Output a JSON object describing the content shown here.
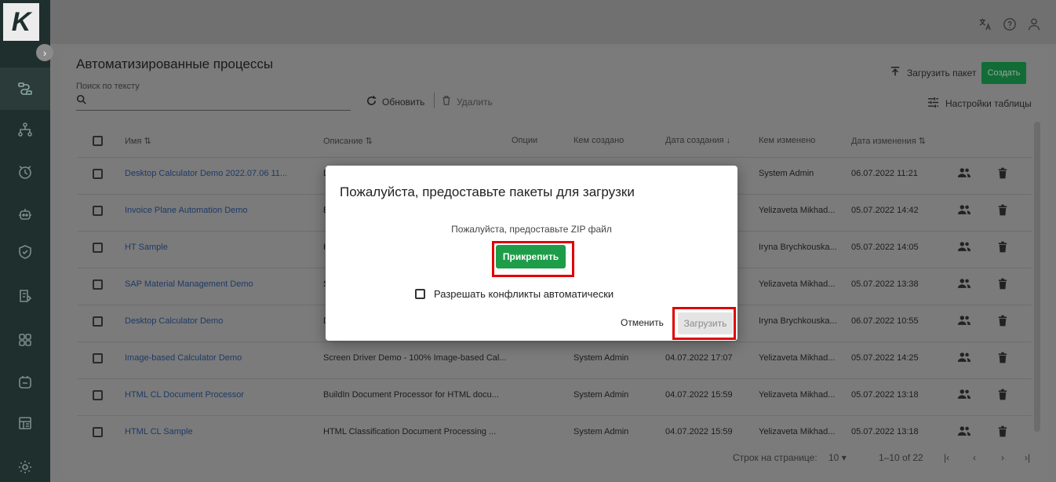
{
  "app": {
    "logo_letter": "K"
  },
  "sidebar": {
    "items": [
      {
        "icon": "processes-icon"
      },
      {
        "icon": "hierarchy-icon"
      },
      {
        "icon": "clock-icon"
      },
      {
        "icon": "robot-icon"
      },
      {
        "icon": "shield-icon"
      },
      {
        "icon": "queue-icon"
      },
      {
        "icon": "grid-icon"
      },
      {
        "icon": "storage-icon"
      },
      {
        "icon": "calendar-icon"
      },
      {
        "icon": "settings-icon"
      }
    ]
  },
  "header": {
    "title": "Автоматизированные процессы",
    "search_label": "Поиск по тексту",
    "refresh_label": "Обновить",
    "delete_label": "Удалить",
    "upload_package_label": "Загрузить пакет",
    "create_label": "Создать",
    "table_settings_label": "Настройки таблицы"
  },
  "table": {
    "columns": [
      "Имя",
      "Описание",
      "Опции",
      "Кем создано",
      "Дата создания",
      "Кем изменено",
      "Дата изменения"
    ],
    "rows": [
      {
        "name": "Desktop Calculator Demo 2022.07.06 11...",
        "description": "D",
        "created_by": "",
        "created_at": "",
        "modified_by": "System Admin",
        "modified_at": "06.07.2022 11:21"
      },
      {
        "name": "Invoice Plane Automation Demo",
        "description": "E",
        "created_by": "",
        "created_at": "",
        "modified_by": "Yelizaveta Mikhad...",
        "modified_at": "05.07.2022 14:42"
      },
      {
        "name": "HT Sample",
        "description": "H",
        "created_by": "",
        "created_at": "",
        "modified_by": "Iryna Brychkouska...",
        "modified_at": "05.07.2022 14:05"
      },
      {
        "name": "SAP Material Management Demo",
        "description": "S",
        "created_by": "",
        "created_at": "",
        "modified_by": "Yelizaveta Mikhad...",
        "modified_at": "05.07.2022 13:38"
      },
      {
        "name": "Desktop Calculator Demo",
        "description": "D",
        "created_by": "",
        "created_at": "",
        "modified_by": "Iryna Brychkouska...",
        "modified_at": "06.07.2022 10:55"
      },
      {
        "name": "Image-based Calculator Demo",
        "description": "Screen Driver Demo - 100% Image-based Cal...",
        "created_by": "System Admin",
        "created_at": "04.07.2022 17:07",
        "modified_by": "Yelizaveta Mikhad...",
        "modified_at": "05.07.2022 14:25"
      },
      {
        "name": "HTML CL Document Processor",
        "description": "BuildIn Document Processor for HTML docu...",
        "created_by": "System Admin",
        "created_at": "04.07.2022 15:59",
        "modified_by": "Yelizaveta Mikhad...",
        "modified_at": "05.07.2022 13:18"
      },
      {
        "name": "HTML CL Sample",
        "description": "HTML Classification Document Processing ...",
        "created_by": "System Admin",
        "created_at": "04.07.2022 15:59",
        "modified_by": "Yelizaveta Mikhad...",
        "modified_at": "05.07.2022 13:18"
      }
    ]
  },
  "pagination": {
    "rows_per_page_label": "Строк на странице:",
    "rows_per_page_value": "10",
    "range": "1–10 of 22"
  },
  "modal": {
    "title": "Пожалуйста, предоставьте пакеты для загрузки",
    "subtitle": "Пожалуйста, предоставьте ZIP файл",
    "attach_label": "Прикрепить",
    "auto_resolve_label": "Разрешать конфликты автоматически",
    "cancel_label": "Отменить",
    "submit_label": "Загрузить"
  },
  "colors": {
    "sidebar": "#1f2f2d",
    "primary_green": "#1e9d49",
    "highlight_red": "#e00000",
    "link_blue": "#1e3a66"
  }
}
